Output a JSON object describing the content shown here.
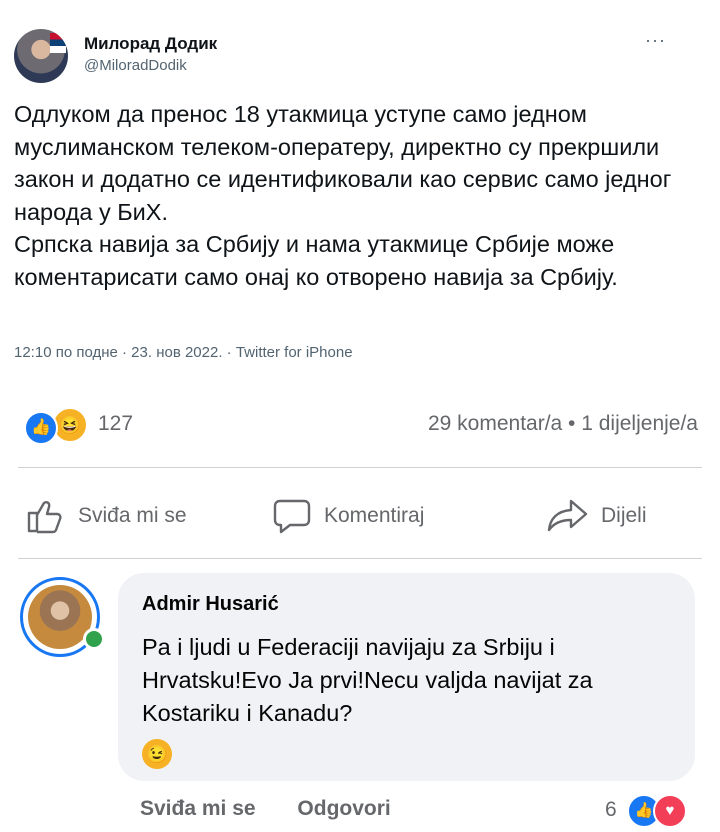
{
  "tweet": {
    "author_name": "Милорад Додик",
    "handle": "@MiloradDodik",
    "more_glyph": "···",
    "text_p1": "Одлуком да пренос 18 утакмица уступе само једном муслиманском телеком-оператеру, директно су прекршили закон и додатно се идентификовали као сервис само једног народа у БиХ.",
    "text_p2": "Српска навија за Србију и нама утакмице Србије може коментарисати само онај ко отворено навија за Србију.",
    "meta": "12:10 по подне · 23. нов 2022. · Twitter for iPhone"
  },
  "post": {
    "reaction_icons": [
      "like-icon",
      "haha-icon"
    ],
    "reaction_count": "127",
    "stats": "29 komentar/a • 1 dijeljenje/a",
    "actions": {
      "like": "Sviđa mi se",
      "comment": "Komentiraj",
      "share": "Dijeli"
    }
  },
  "comment": {
    "author": "Admir Husarić",
    "text": "Pa i ljudi u Federaciji navijaju za Srbiju i Hrvatsku!Evo Ja prvi!Necu valjda navijat za Kostariku i Kanadu?",
    "emoji": "😉",
    "like_label": "Sviđa mi se",
    "reply_label": "Odgovori",
    "reaction_count": "6",
    "reaction_icons": [
      "like-icon",
      "love-icon"
    ]
  },
  "colors": {
    "accent": "#1877f2",
    "muted": "#65676b",
    "online": "#31a24c",
    "love": "#f33e58",
    "bubble": "#f0f2f5"
  }
}
